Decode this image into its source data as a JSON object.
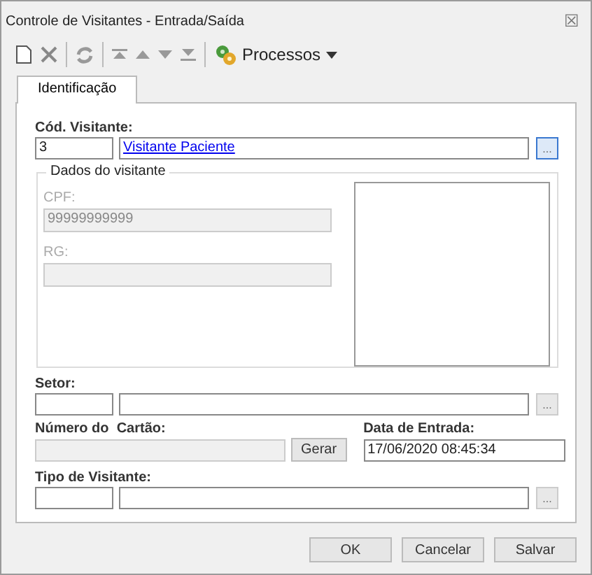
{
  "window": {
    "title": "Controle de Visitantes - Entrada/Saída",
    "close": "☒"
  },
  "toolbar": {
    "menu_label": "Processos"
  },
  "tabs": [
    {
      "label": "Identificação",
      "selected": true
    }
  ],
  "visitor_code": {
    "label": "Cód. Visitante:",
    "code": "3",
    "name": "Visitante Paciente",
    "lookup": "..."
  },
  "visitor_data": {
    "legend": "Dados do visitante",
    "fields": [
      {
        "label": "CPF:",
        "value": "99999999999",
        "disabled": true
      },
      {
        "label": "RG:",
        "disabled": true
      }
    ]
  },
  "sector": {
    "label": "Setor:",
    "lookup": "..."
  },
  "card_number": {
    "label": "Número do  Cartão:",
    "disabled": true,
    "button": "Gerar"
  },
  "entry_date": {
    "label": "Data de Entrada:",
    "value": "17/06/2020 08:45:34"
  },
  "visitor_type": {
    "label": "Tipo de Visitante:",
    "lookup": "..."
  },
  "buttons": [
    "OK",
    "Cancelar",
    "Salvar"
  ]
}
